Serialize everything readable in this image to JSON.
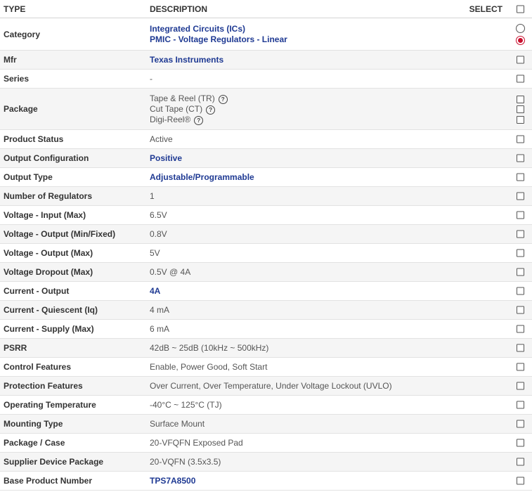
{
  "header": {
    "type_label": "TYPE",
    "description_label": "DESCRIPTION",
    "select_label": "SELECT"
  },
  "rows": [
    {
      "type": "Category",
      "lines": [
        "Integrated Circuits (ICs)",
        "PMIC - Voltage Regulators - Linear"
      ]
    },
    {
      "type": "Mfr",
      "value": "Texas Instruments"
    },
    {
      "type": "Series",
      "value": "-"
    },
    {
      "type": "Package",
      "options": [
        "Tape & Reel (TR)",
        "Cut Tape (CT)",
        "Digi-Reel®"
      ]
    },
    {
      "type": "Product Status",
      "value": "Active"
    },
    {
      "type": "Output Configuration",
      "value": "Positive"
    },
    {
      "type": "Output Type",
      "value": "Adjustable/Programmable"
    },
    {
      "type": "Number of Regulators",
      "value": "1"
    },
    {
      "type": "Voltage - Input (Max)",
      "value": "6.5V"
    },
    {
      "type": "Voltage - Output (Min/Fixed)",
      "value": "0.8V"
    },
    {
      "type": "Voltage - Output (Max)",
      "value": "5V"
    },
    {
      "type": "Voltage Dropout (Max)",
      "value": "0.5V @ 4A"
    },
    {
      "type": "Current - Output",
      "value": "4A"
    },
    {
      "type": "Current - Quiescent (Iq)",
      "value": "4 mA"
    },
    {
      "type": "Current - Supply (Max)",
      "value": "6 mA"
    },
    {
      "type": "PSRR",
      "value": "42dB ~ 25dB (10kHz ~ 500kHz)"
    },
    {
      "type": "Control Features",
      "value": "Enable, Power Good, Soft Start"
    },
    {
      "type": "Protection Features",
      "value": "Over Current, Over Temperature, Under Voltage Lockout (UVLO)"
    },
    {
      "type": "Operating Temperature",
      "value": "-40°C ~ 125°C (TJ)"
    },
    {
      "type": "Mounting Type",
      "value": "Surface Mount"
    },
    {
      "type": "Package / Case",
      "value": "20-VFQFN Exposed Pad"
    },
    {
      "type": "Supplier Device Package",
      "value": "20-VQFN (3.5x3.5)"
    },
    {
      "type": "Base Product Number",
      "value": "TPS7A8500"
    }
  ],
  "help_glyph": "?",
  "colors": {
    "link": "#1f3a93",
    "radio_selected": "#c8102e",
    "row_alt": "#f5f5f5"
  }
}
